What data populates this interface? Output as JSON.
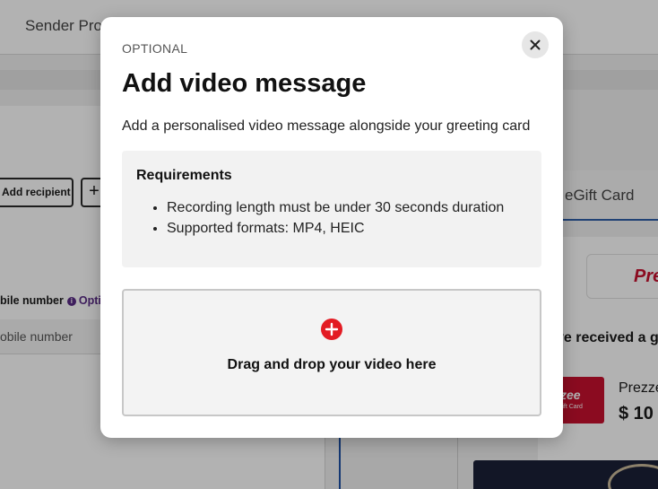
{
  "background": {
    "topbar_title": "Sender Prof",
    "add_recipient_label": "Add recipient",
    "add_plus": "+",
    "mobile_label": "bile number",
    "info_glyph": "i",
    "optional_tag": "Opti",
    "mobile_placeholder": "obile number",
    "tab_label": "eGift Card",
    "logo_text": "Pre",
    "received_text": "ve received a g",
    "card_brand": "zzee",
    "card_sub": "eGift Card",
    "product_name": "Prezze",
    "price": "$ 10"
  },
  "modal": {
    "eyebrow": "OPTIONAL",
    "title": "Add video message",
    "description": "Add a personalised video message alongside your greeting card",
    "requirements": {
      "title": "Requirements",
      "items": [
        "Recording length must be under 30 seconds duration",
        "Supported formats: MP4, HEIC"
      ]
    },
    "dropzone_label": "Drag and drop your video here",
    "accent_color": "#e31b23"
  }
}
